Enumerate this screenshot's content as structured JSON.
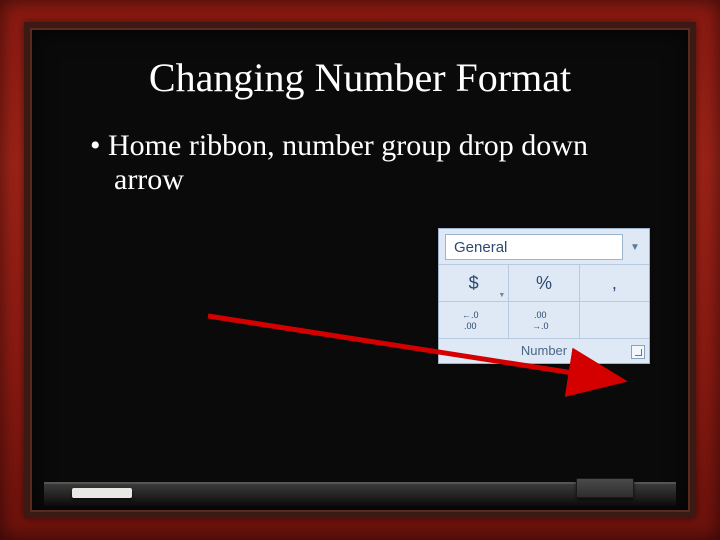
{
  "slide": {
    "title": "Changing Number Format",
    "bullet_line1": "Home ribbon, number group drop down",
    "bullet_line2": "arrow"
  },
  "ribbon": {
    "format_selected": "General",
    "buttons": {
      "currency": "$",
      "percent": "%",
      "comma": ","
    },
    "decimal": {
      "increase_top": "←.0",
      "increase_bot": ".00",
      "decrease_top": ".00",
      "decrease_bot": "→.0"
    },
    "group_label": "Number"
  }
}
